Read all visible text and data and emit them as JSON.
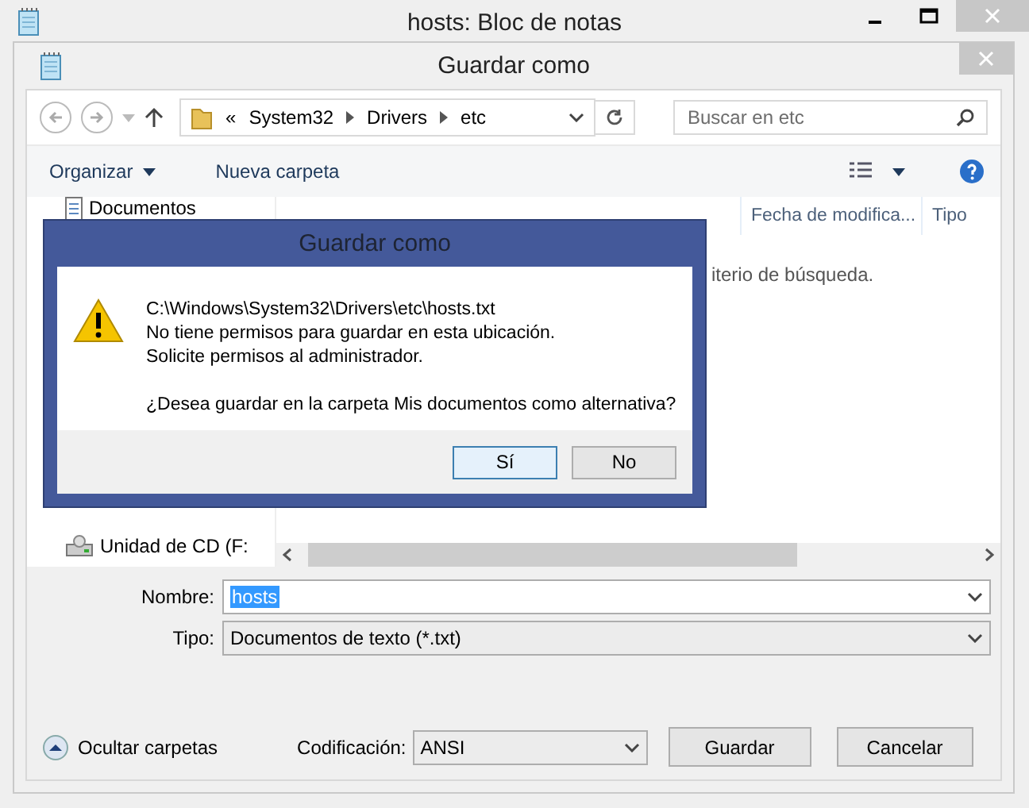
{
  "notepad_window": {
    "title": "hosts: Bloc de notas"
  },
  "save_dialog": {
    "title": "Guardar como",
    "address": {
      "prefix": "«",
      "crumbs": [
        "System32",
        "Drivers",
        "etc"
      ]
    },
    "search": {
      "placeholder": "Buscar en etc"
    },
    "toolbar": [
      "Organizar",
      "Nueva carpeta"
    ],
    "nav_items": [
      {
        "label": "Documentos",
        "kind": "docs"
      },
      {
        "label": "Unidad de CD (F:",
        "kind": "cd"
      }
    ],
    "columns": [
      "Fecha de modifica...",
      "Tipo"
    ],
    "empty_message": "iterio de búsqueda.",
    "filename": {
      "label": "Nombre:",
      "value": "hosts"
    },
    "file_type": {
      "label": "Tipo:",
      "value": "Documentos de texto (*.txt)"
    },
    "hide_folders": "Ocultar carpetas",
    "encoding": {
      "label": "Codificación:",
      "value": "ANSI"
    },
    "buttons": [
      "Guardar",
      "Cancelar"
    ]
  },
  "message_box": {
    "title": "Guardar como",
    "lines": [
      "C:\\Windows\\System32\\Drivers\\etc\\hosts.txt",
      "No tiene permisos para guardar en esta ubicación.",
      "Solicite permisos al administrador."
    ],
    "question": "¿Desea guardar en la carpeta Mis documentos como alternativa?",
    "buttons": [
      {
        "label": "Sí",
        "selected": true
      },
      {
        "label": "No",
        "selected": false
      }
    ]
  }
}
